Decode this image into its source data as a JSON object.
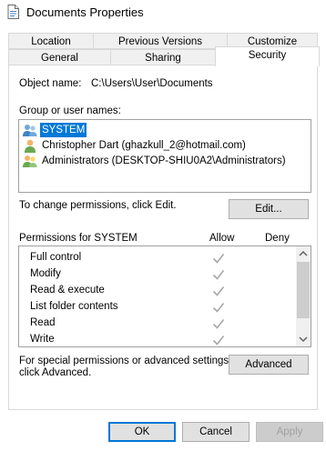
{
  "window": {
    "title": "Documents Properties",
    "icon": "document-properties-icon"
  },
  "tabs": {
    "row1": [
      "Location",
      "Previous Versions",
      "Customize"
    ],
    "row2": [
      "General",
      "Sharing",
      "Security"
    ],
    "active": "Security"
  },
  "object": {
    "label": "Object name:",
    "value": "C:\\Users\\User\\Documents"
  },
  "groups": {
    "label": "Group or user names:",
    "items": [
      {
        "name": "SYSTEM",
        "icon": "user-group-icon",
        "selected": true
      },
      {
        "name": "Christopher Dart (ghazkull_2@hotmail.com)",
        "icon": "user-icon",
        "selected": false
      },
      {
        "name": "Administrators (DESKTOP-SHIU0A2\\Administrators)",
        "icon": "user-group-icon",
        "selected": false
      }
    ]
  },
  "change": {
    "text": "To change permissions, click Edit.",
    "edit_label": "Edit..."
  },
  "permissions": {
    "header": "Permissions for SYSTEM",
    "allow_label": "Allow",
    "deny_label": "Deny",
    "rows": [
      {
        "name": "Full control",
        "allow": true,
        "deny": false
      },
      {
        "name": "Modify",
        "allow": true,
        "deny": false
      },
      {
        "name": "Read & execute",
        "allow": true,
        "deny": false
      },
      {
        "name": "List folder contents",
        "allow": true,
        "deny": false
      },
      {
        "name": "Read",
        "allow": true,
        "deny": false
      },
      {
        "name": "Write",
        "allow": true,
        "deny": false
      }
    ]
  },
  "special": {
    "line1": "For special permissions or advanced settings,",
    "line2": "click Advanced.",
    "advanced_label": "Advanced"
  },
  "footer": {
    "ok_label": "OK",
    "cancel_label": "Cancel",
    "apply_label": "Apply"
  },
  "colors": {
    "accent": "#0078d7",
    "check_gray": "#a8a8a8",
    "border": "#adadad"
  }
}
